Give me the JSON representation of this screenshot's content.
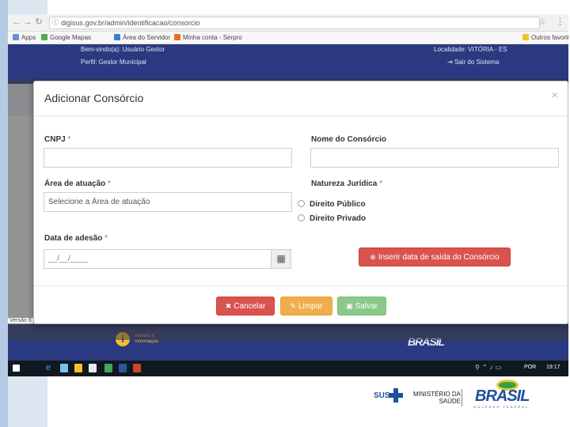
{
  "browser": {
    "url": "digisus.gov.br/admin/identificacao/consorcio",
    "bookmarks": [
      "Apps",
      "Google Mapas",
      "Área do Servidor",
      "Minha conta - Serpro"
    ],
    "right_bookmark": "Outros favoritos"
  },
  "header": {
    "user": "Bem-vindo(a): Usuário Gestor",
    "perfil": "Perfil: Gestor Municipal",
    "localidade": "Localidade: VITÓRIA - ES",
    "sair": "Sair do Sistema"
  },
  "modal": {
    "title": "Adicionar Consórcio",
    "close_glyph": "×",
    "cnpj_label": "CNPJ",
    "cnpj_value": "",
    "nome_label": "Nome do Consórcio",
    "nome_value": "",
    "area_label": "Área de atuação",
    "area_placeholder": "Selecione a Área de atuação",
    "natureza_label": "Natureza Jurídica",
    "natureza_options": [
      "Direito Público",
      "Direito Privado"
    ],
    "data_label": "Data de adesão",
    "data_placeholder": "__/__/____",
    "inserir_saida_label": "Inserir data de saída do Consórcio",
    "required_mark": "*",
    "buttons": {
      "cancelar": "Cancelar",
      "limpar": "Limpar",
      "salvar": "Salvar"
    }
  },
  "footer": {
    "info_title": "Acesso à Informação",
    "brasil": "BRASIL",
    "version": "Versão 6"
  },
  "taskbar": {
    "lang": "POR",
    "clock": "19:17"
  },
  "slide_logos": {
    "sus": "SUS",
    "ministerio": "MINISTÉRIO DA SAÚDE",
    "brasil": "BRASIL",
    "brasil_sub": "GOVERNO FEDERAL"
  },
  "colors": {
    "header_blue": "#2b3a80",
    "danger": "#d9534f",
    "warning": "#f0ad4e",
    "success_disabled": "#8ac98a"
  }
}
